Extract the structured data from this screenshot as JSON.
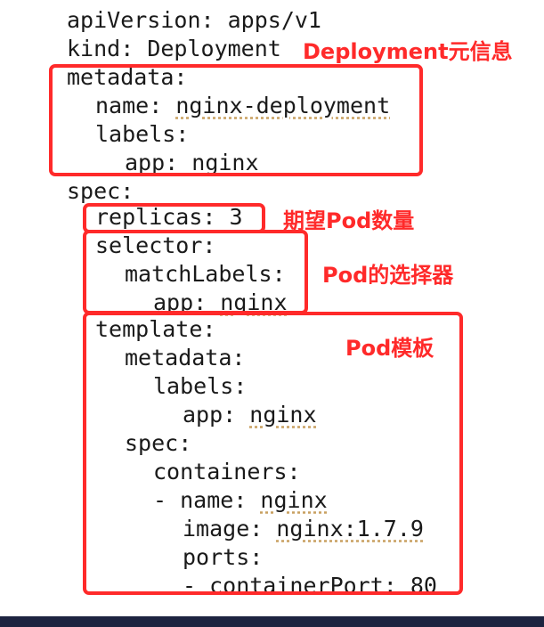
{
  "yaml": {
    "l01": {
      "key": "apiVersion: ",
      "val": "apps/v1"
    },
    "l02": {
      "key": "kind: ",
      "val": "Deployment"
    },
    "l03": {
      "key": "metadata:"
    },
    "l04": {
      "key": "name: ",
      "val": "nginx-deployment"
    },
    "l05": {
      "key": "labels:"
    },
    "l06": {
      "key": "app: ",
      "val": "nginx"
    },
    "l07": {
      "key": "spec:"
    },
    "l08": {
      "key": "replicas: ",
      "val": "3"
    },
    "l09": {
      "key": "selector:"
    },
    "l10": {
      "key": "matchLabels:"
    },
    "l11": {
      "key": "app: ",
      "val": "nginx"
    },
    "l12": {
      "key": "template:"
    },
    "l13": {
      "key": "metadata:"
    },
    "l14": {
      "key": "labels:"
    },
    "l15": {
      "key": "app: ",
      "val": "nginx"
    },
    "l16": {
      "key": "spec:"
    },
    "l17": {
      "key": "containers:"
    },
    "l18": {
      "key": "- name: ",
      "val": "nginx"
    },
    "l19": {
      "key": "image: ",
      "val": "nginx:1.7.9"
    },
    "l20": {
      "key": "ports:"
    },
    "l21": {
      "key": "- containerPort: ",
      "val": "80"
    }
  },
  "annotations": {
    "deployment_meta": "Deployment元信息",
    "expected_pods": "期望Pod数量",
    "pod_selector": "Pod的选择器",
    "pod_template": "Pod模板"
  },
  "colors": {
    "highlight": "#ff2a2a",
    "code_text": "#1a1a1a",
    "footer_bar": "#1d2440"
  }
}
